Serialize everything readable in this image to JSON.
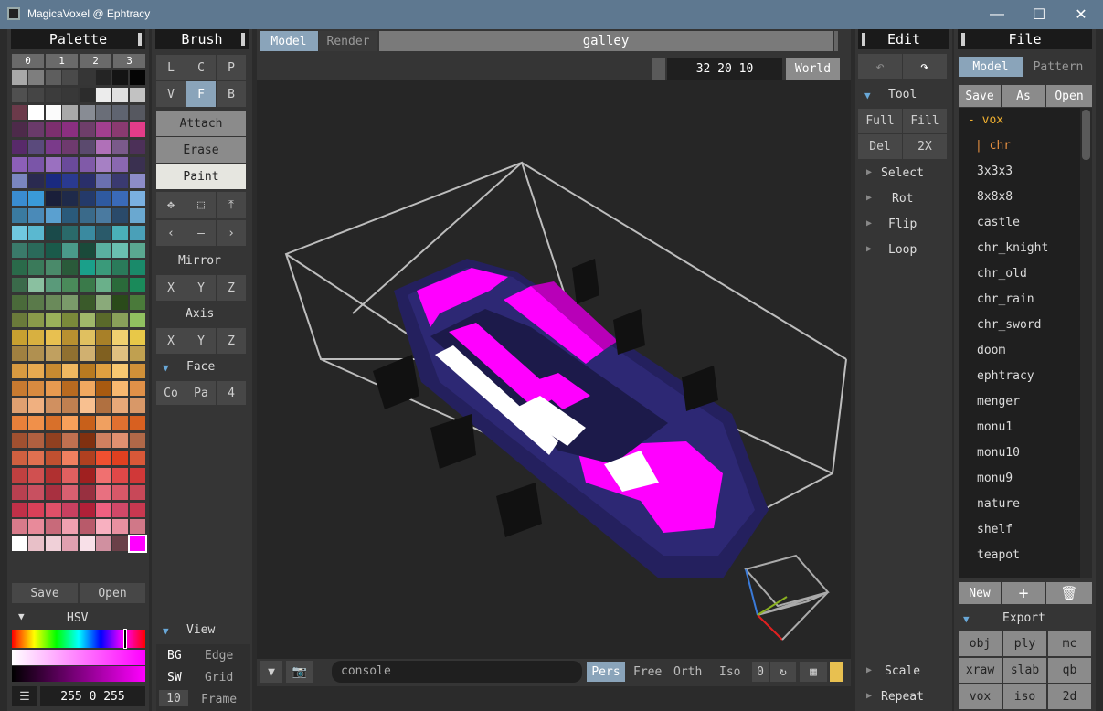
{
  "window": {
    "title": "MagicaVoxel @ Ephtracy",
    "minimize": "—",
    "maximize": "☐",
    "close": "✕"
  },
  "palette": {
    "title": "Palette",
    "tabs": [
      "0",
      "1",
      "2",
      "3"
    ],
    "save": "Save",
    "open": "Open",
    "hsv": "HSV",
    "hsv_value": "255 0 255",
    "selected": "#ff00ff",
    "colors": [
      [
        "#a8a8a8",
        "#7e7e7e",
        "#5e5e5e",
        "#4a4a4a",
        "#363636",
        "#242424",
        "#141414",
        "#050505"
      ],
      [
        "#505050",
        "#454545",
        "#3c3c3c",
        "#383838",
        "#2c2c2c",
        "#ececec",
        "#e0e0e0",
        "#c2c2c2"
      ],
      [
        "#6b3a4a",
        "#ffffff",
        "#fbfbfb",
        "#a9a9a9",
        "#888c94",
        "#6a6e78",
        "#5f6470",
        "#565860"
      ],
      [
        "#4d2a4a",
        "#6a3a6a",
        "#7c2f6e",
        "#8b2f80",
        "#6e3e6a",
        "#a23f8f",
        "#8a3a70",
        "#e23c88"
      ],
      [
        "#582a6a",
        "#5a4a7c",
        "#7a3a8a",
        "#6e3a6e",
        "#5b4a6e",
        "#b070b8",
        "#7a5a8a",
        "#4c3058"
      ],
      [
        "#8c5fb8",
        "#7a55a8",
        "#9a70c0",
        "#6a4a9a",
        "#805aa8",
        "#a680c4",
        "#8a68b0",
        "#3a3050"
      ],
      [
        "#7a86c0",
        "#2a2a50",
        "#1a2a80",
        "#2a3a90",
        "#2a2f6a",
        "#6a70b0",
        "#3a3a70",
        "#8c8cc8"
      ],
      [
        "#3a8cd0",
        "#3a9ad8",
        "#1a1f3a",
        "#1f2a4a",
        "#243a6a",
        "#2f5aa0",
        "#3a6ab8",
        "#7ab0e0"
      ],
      [
        "#3a7aa0",
        "#4a8ab8",
        "#5aa0d0",
        "#2a5a7a",
        "#3a6a8a",
        "#4a7aa0",
        "#2a4a6a",
        "#6aa8d0"
      ],
      [
        "#70c8e0",
        "#5ab8d0",
        "#1a4a4a",
        "#2a6a6a",
        "#3a8aa0",
        "#2a5a6a",
        "#4ab0b8",
        "#4aa0b8"
      ],
      [
        "#3a7a6a",
        "#2a6a5a",
        "#1a5a4a",
        "#4a9a8a",
        "#1a4a3a",
        "#5ab0a0",
        "#6ac0b0",
        "#5aa890"
      ],
      [
        "#2a6a4a",
        "#3a7a5a",
        "#4a8a6a",
        "#2a5a3a",
        "#1aa08a",
        "#3a9a7a",
        "#2a7a5a",
        "#1a8a6a"
      ],
      [
        "#3a6a4a",
        "#8ac0a0",
        "#5a9a7a",
        "#4a8a5a",
        "#3a7a4a",
        "#6ab08a",
        "#2a6a3a",
        "#1a8a5a"
      ],
      [
        "#4a6a3a",
        "#5a7a4a",
        "#6a8a5a",
        "#7a9a6a",
        "#3a5a2a",
        "#8aaa7a",
        "#2a4a1a",
        "#4a7a3a"
      ],
      [
        "#6a7a3a",
        "#8a9a4a",
        "#9ab05a",
        "#7a8a3a",
        "#a0b86a",
        "#5a6a2a",
        "#8aa05a",
        "#90c060"
      ],
      [
        "#c8a030",
        "#d8b040",
        "#e8c050",
        "#b89030",
        "#e0c060",
        "#a88028",
        "#f0d070",
        "#e8c848"
      ],
      [
        "#a08040",
        "#b09050",
        "#c0a060",
        "#907030",
        "#d0b070",
        "#806020",
        "#e0c080",
        "#c0a050"
      ],
      [
        "#d89a40",
        "#e8aa50",
        "#c88a30",
        "#f0b860",
        "#b87a20",
        "#e0a040",
        "#f8c870",
        "#d09038"
      ],
      [
        "#c87a30",
        "#d88a40",
        "#e89a50",
        "#b86a20",
        "#f0a860",
        "#a85a10",
        "#f8b870",
        "#e09048"
      ],
      [
        "#e0a070",
        "#f0b080",
        "#d09060",
        "#c08050",
        "#f8c090",
        "#b07040",
        "#e8a878",
        "#d89868"
      ],
      [
        "#e8803a",
        "#f0904a",
        "#d8702a",
        "#f8a05a",
        "#c8601a",
        "#f0a060",
        "#e07030",
        "#d86020"
      ],
      [
        "#a05030",
        "#b06040",
        "#904020",
        "#c07050",
        "#803010",
        "#d08060",
        "#e09070",
        "#b06848"
      ],
      [
        "#d06040",
        "#e07050",
        "#c05030",
        "#f08060",
        "#b04020",
        "#f05030",
        "#e04020",
        "#d85838"
      ],
      [
        "#c04040",
        "#d05050",
        "#b03030",
        "#e06060",
        "#a02020",
        "#f07070",
        "#e04848",
        "#d03838"
      ],
      [
        "#b84050",
        "#c85060",
        "#a83040",
        "#d86070",
        "#983040",
        "#e87080",
        "#d85868",
        "#c84858"
      ],
      [
        "#c03048",
        "#d84058",
        "#e05068",
        "#c84060",
        "#b02038",
        "#f06080",
        "#d04868",
        "#c83850"
      ],
      [
        "#d87a8a",
        "#e88a9a",
        "#c86a7a",
        "#f0a0b0",
        "#b85a6a",
        "#f8b0c0",
        "#e890a0",
        "#d07888"
      ],
      [
        "#ffffff",
        "#e8c0c8",
        "#f0d0d8",
        "#e0a0b0",
        "#f8e0e8",
        "#d090a0",
        "#6a4048",
        "#ff00ff"
      ]
    ]
  },
  "brush": {
    "title": "Brush",
    "row1": [
      "L",
      "C",
      "P"
    ],
    "row2": [
      "V",
      "F",
      "B"
    ],
    "modes": [
      "Attach",
      "Erase",
      "Paint"
    ],
    "mirror": "Mirror",
    "axis": "Axis",
    "xyz": [
      "X",
      "Y",
      "Z"
    ],
    "face": "Face",
    "face_buttons": [
      "Co",
      "Pa",
      "4"
    ],
    "view": "View",
    "bg": "BG",
    "edge": "Edge",
    "sw": "SW",
    "grid": "Grid",
    "frame_num": "10",
    "frame": "Frame"
  },
  "viewport": {
    "tab_model": "Model",
    "tab_render": "Render",
    "file_name": "galley",
    "dims": "32 20 10",
    "world": "World",
    "console": "console",
    "modes": [
      "Pers",
      "Free",
      "Orth",
      "Iso"
    ],
    "zero": "0"
  },
  "edit": {
    "title": "Edit",
    "tool": "Tool",
    "buttons": [
      "Full",
      "Fill",
      "Del",
      "2X"
    ],
    "items": [
      "Select",
      "Rot",
      "Flip",
      "Loop"
    ],
    "scale": "Scale",
    "repeat": "Repeat"
  },
  "file": {
    "title": "File",
    "tab_model": "Model",
    "tab_pattern": "Pattern",
    "save": "Save",
    "as": "As",
    "open": "Open",
    "folder1": "- vox",
    "folder2": "| chr",
    "items": [
      "3x3x3",
      "8x8x8",
      "castle",
      "chr_knight",
      "chr_old",
      "chr_rain",
      "chr_sword",
      "doom",
      "ephtracy",
      "menger",
      "monu1",
      "monu10",
      "monu9",
      "nature",
      "shelf",
      "teapot"
    ],
    "new": "New",
    "plus": "+",
    "export": "Export",
    "export_buttons": [
      "obj",
      "ply",
      "mc",
      "xraw",
      "slab",
      "qb",
      "vox",
      "iso",
      "2d"
    ]
  }
}
